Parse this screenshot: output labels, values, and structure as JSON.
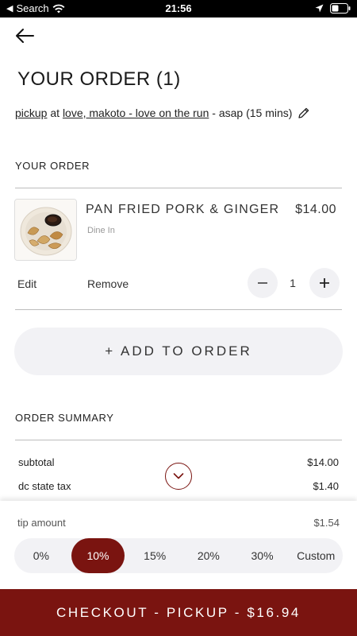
{
  "status_bar": {
    "carrier": "Search",
    "time": "21:56",
    "icons": [
      "wifi-icon",
      "location-arrow-icon",
      "battery-icon"
    ]
  },
  "header": {
    "back_icon": "arrow-left-icon",
    "title": "YOUR ORDER (1)"
  },
  "order_meta": {
    "mode": "pickup",
    "at": "at",
    "location": "love, makoto - love on the run",
    "timing": "- asap (15 mins)",
    "edit_icon": "pencil-icon"
  },
  "your_order": {
    "label": "YOUR ORDER",
    "items": [
      {
        "name": "PAN FRIED PORK & GINGER",
        "price": "$14.00",
        "sub": "Dine In",
        "edit_label": "Edit",
        "remove_label": "Remove",
        "quantity": "1",
        "decrement_icon": "minus-icon",
        "increment_icon": "plus-icon"
      }
    ],
    "add_button": "+ ADD TO ORDER"
  },
  "order_summary": {
    "label": "ORDER SUMMARY",
    "rows": [
      {
        "label": "subtotal",
        "value": "$14.00"
      },
      {
        "label": "dc state tax",
        "value": "$1.40"
      }
    ],
    "expand_icon": "chevron-down-icon"
  },
  "tip": {
    "label": "tip amount",
    "amount": "$1.54",
    "options": [
      "0%",
      "10%",
      "15%",
      "20%",
      "30%",
      "Custom"
    ],
    "selected": "10%"
  },
  "checkout": {
    "label": "CHECKOUT - PICKUP - $16.94"
  },
  "colors": {
    "accent": "#7a1410",
    "pill_background": "#f2f2f5"
  }
}
